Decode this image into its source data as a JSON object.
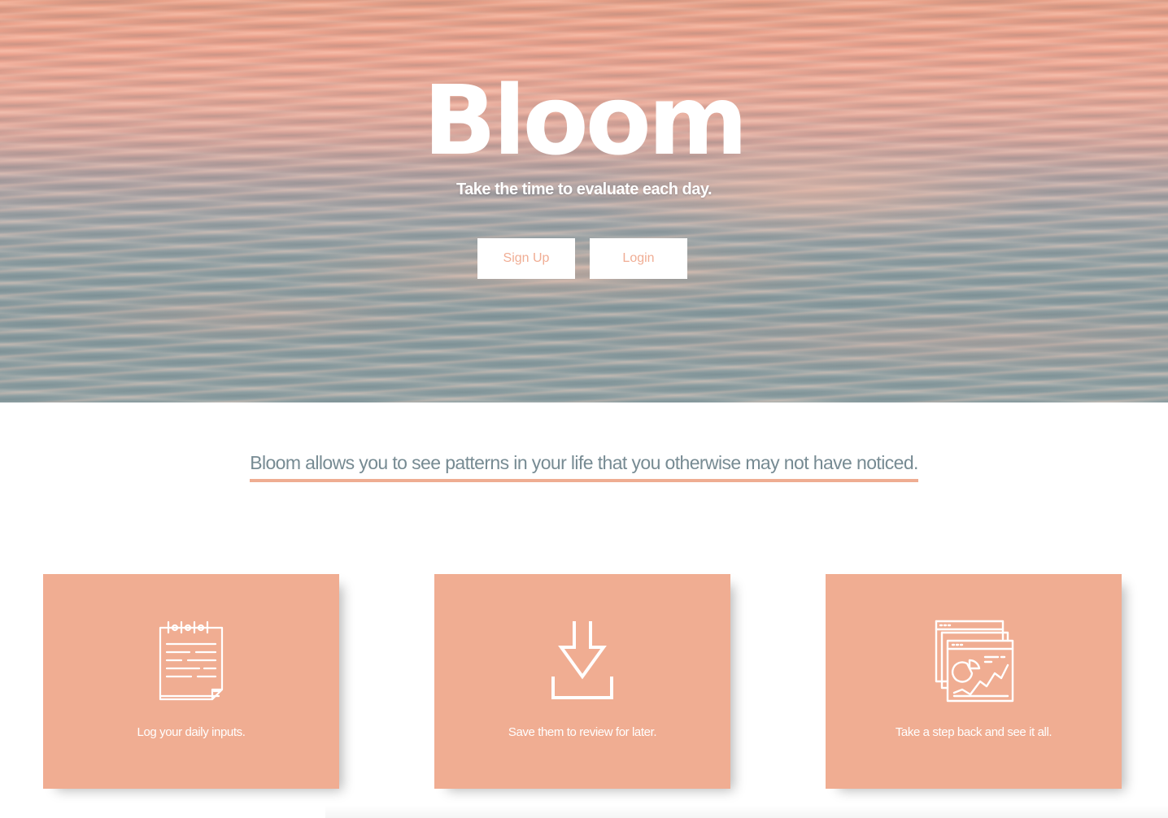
{
  "hero": {
    "title": "Bloom",
    "subtitle": "Take the time to evaluate each day.",
    "signup_label": "Sign Up",
    "login_label": "Login"
  },
  "tagline": "Bloom allows you to see patterns in your life that you otherwise may not have noticed.",
  "features": [
    {
      "icon": "notepad-icon",
      "label": "Log your daily inputs."
    },
    {
      "icon": "download-icon",
      "label": "Save them to review for later."
    },
    {
      "icon": "analytics-dashboard-icon",
      "label": "Take a step back and see it all."
    }
  ],
  "colors": {
    "accent": "#f0ad92",
    "tagline_text": "#778b93",
    "white": "#ffffff"
  }
}
